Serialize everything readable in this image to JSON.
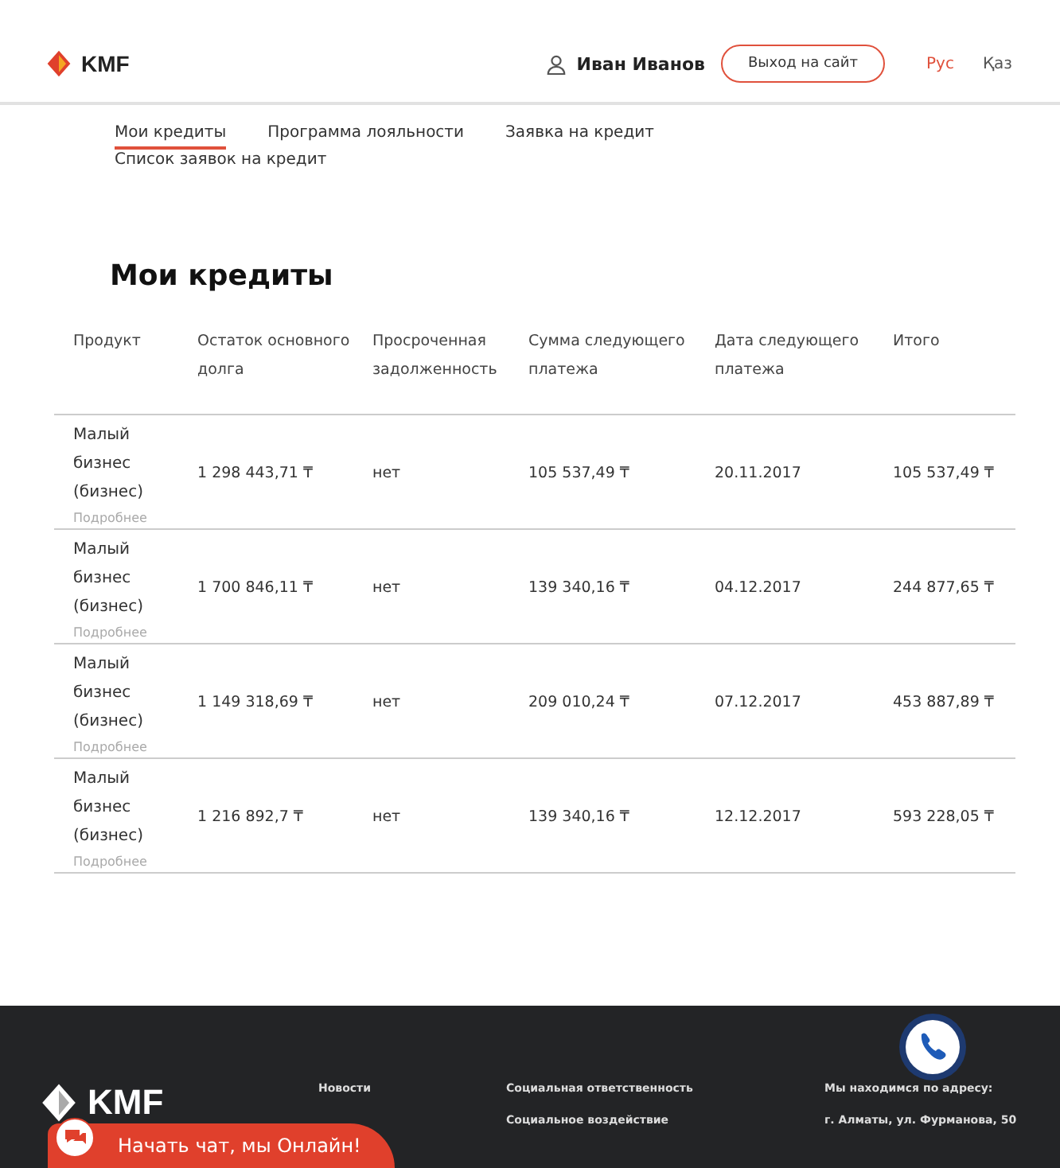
{
  "header": {
    "logo": "KMF",
    "user": "Иван Иванов",
    "exit_button": "Выход на сайт",
    "languages": [
      {
        "label": "Рус",
        "selected": true
      },
      {
        "label": "Қаз",
        "selected": false
      }
    ]
  },
  "tabs": [
    {
      "label": "Мои кредиты",
      "selected": true
    },
    {
      "label": "Программа лояльности",
      "selected": false
    },
    {
      "label": "Заявка на кредит",
      "selected": false
    },
    {
      "label": "Список заявок на кредит",
      "selected": false
    }
  ],
  "title": "Мои кредиты",
  "table": {
    "columns": [
      "Продукт",
      "Остаток основного долга",
      "Просроченная задолженность",
      "Сумма следующего платежа",
      "Дата следующего платежа",
      "Итого"
    ],
    "rows": [
      {
        "details": "Подробнее",
        "cells": [
          "Малый бизнес (бизнес)",
          "1 298 443,71 ₸",
          "нет",
          "105 537,49 ₸",
          "20.11.2017",
          "105 537,49 ₸"
        ]
      },
      {
        "details": "Подробнее",
        "cells": [
          "Малый бизнес (бизнес)",
          "1 700 846,11 ₸",
          "нет",
          "139 340,16 ₸",
          "04.12.2017",
          "244 877,65 ₸"
        ]
      },
      {
        "details": "Подробнее",
        "cells": [
          "Малый бизнес (бизнес)",
          "1 149 318,69 ₸",
          "нет",
          "209 010,24 ₸",
          "07.12.2017",
          "453 887,89 ₸"
        ]
      },
      {
        "details": "Подробнее",
        "cells": [
          "Малый бизнес (бизнес)",
          "1 216 892,7 ₸",
          "нет",
          "139 340,16 ₸",
          "12.12.2017",
          "593 228,05 ₸"
        ]
      }
    ]
  },
  "footer": {
    "logo": "KMF",
    "links_1": [
      "Новости"
    ],
    "links_2": [
      "Социальная ответственность",
      "Социальное воздействие"
    ],
    "address_title": "Мы находимся по адресу:",
    "address": "г. Алматы, ул. Фурманова, 50"
  },
  "chat": {
    "label": "Начать чат, мы Онлайн!"
  }
}
